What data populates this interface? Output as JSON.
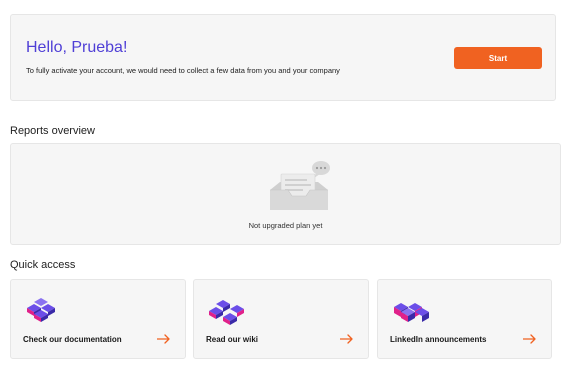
{
  "welcome": {
    "greeting": "Hello, Prueba!",
    "message": "To fully activate your account, we would need to collect a few data from you and your company",
    "start_label": "Start"
  },
  "reports": {
    "title": "Reports overview",
    "empty_text": "Not upgraded plan yet"
  },
  "quick_access": {
    "title": "Quick access",
    "items": [
      {
        "label": "Check our documentation",
        "icon": "cubes-icon"
      },
      {
        "label": "Read our wiki",
        "icon": "cubes-icon"
      },
      {
        "label": "LinkedIn announcements",
        "icon": "cubes-icon"
      }
    ]
  },
  "colors": {
    "accent": "#f06221",
    "greeting": "#4f3fd6",
    "cube_purple": "#5b3fd9",
    "cube_pink": "#e0218a",
    "card_bg": "#f6f6f6"
  }
}
